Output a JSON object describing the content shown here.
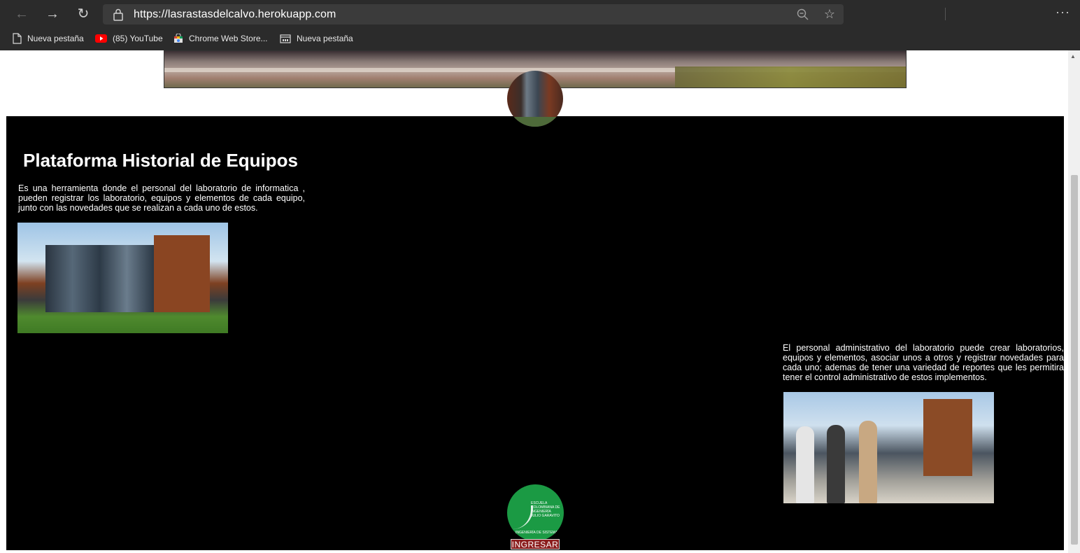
{
  "browser": {
    "url": "https://lasrastasdelcalvo.herokuapp.com",
    "back_icon": "←",
    "forward_icon": "→",
    "refresh_icon": "↻",
    "star_icon": "☆",
    "menu_icon": "···",
    "bookmarks": [
      {
        "label": "Nueva pestaña",
        "icon": "page-icon"
      },
      {
        "label": "(85) YouTube",
        "icon": "youtube-icon"
      },
      {
        "label": "Chrome Web Store...",
        "icon": "chrome-web-store-icon"
      },
      {
        "label": "Nueva pestaña",
        "icon": "window-icon"
      }
    ]
  },
  "page": {
    "title": "Plataforma Historial de Equipos",
    "description_1": "Es una herramienta donde el personal del laboratorio de informatica , pueden registrar los laboratorio, equipos y elementos de cada equipo, junto con las novedades que se realizan a cada uno de estos.",
    "description_2": "El personal administrativo del laboratorio puede crear laboratorios, equipos y elementos, asociar unos a otros y registrar novedades para cada uno; ademas de tener una variedad de reportes que les permitira tener el control administrativo de estos implementos.",
    "logo_text": "ESCUELA COLOMBIANA DE INGENIERÍA JULIO GARAVITO",
    "logo_subtext": "INGENIERÍA DE SISTEMAS",
    "ingresar_label": "INGRESAR"
  },
  "colors": {
    "page_background": "#000000",
    "ingresar_button": "#8b1d1d",
    "logo_green": "#1b9a44",
    "chrome_background": "#2b2b2b"
  }
}
